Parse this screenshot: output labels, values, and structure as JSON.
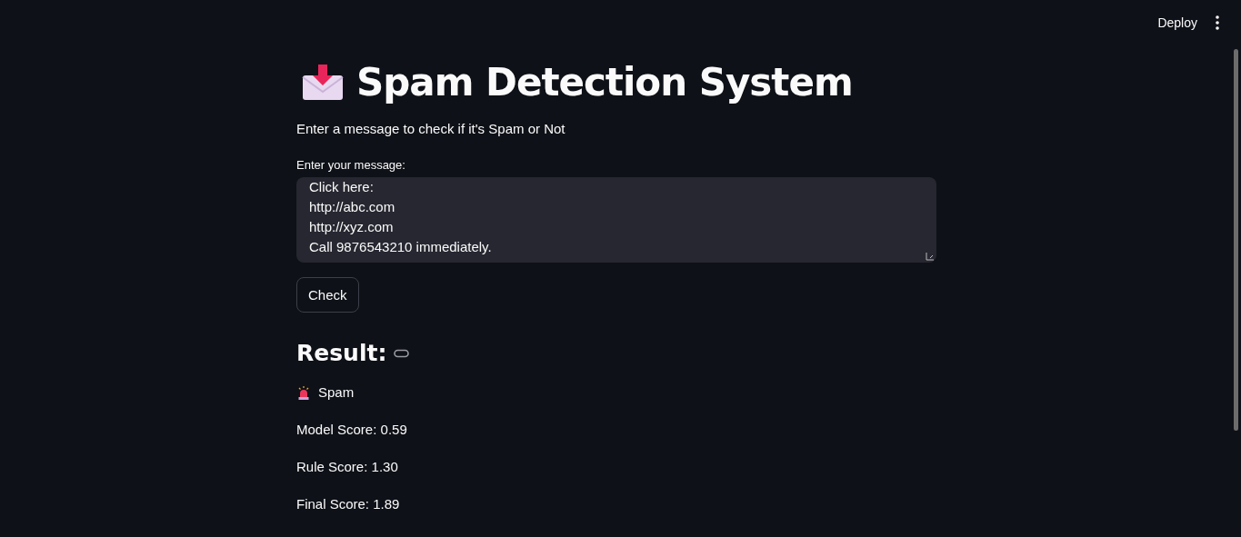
{
  "header": {
    "deploy": "Deploy"
  },
  "title": "Spam Detection System",
  "subtitle": "Enter a message to check if it's Spam or Not",
  "message_field": {
    "label": "Enter your message:",
    "value_lines": [
      "Click here:",
      "http://abc.com",
      "http://xyz.com",
      "Call 9876543210 immediately."
    ]
  },
  "check_button": "Check",
  "result": {
    "heading": "Result:",
    "verdict": "Spam",
    "scores": [
      "Model Score: 0.59",
      "Rule Score: 1.30",
      "Final Score: 1.89"
    ]
  }
}
